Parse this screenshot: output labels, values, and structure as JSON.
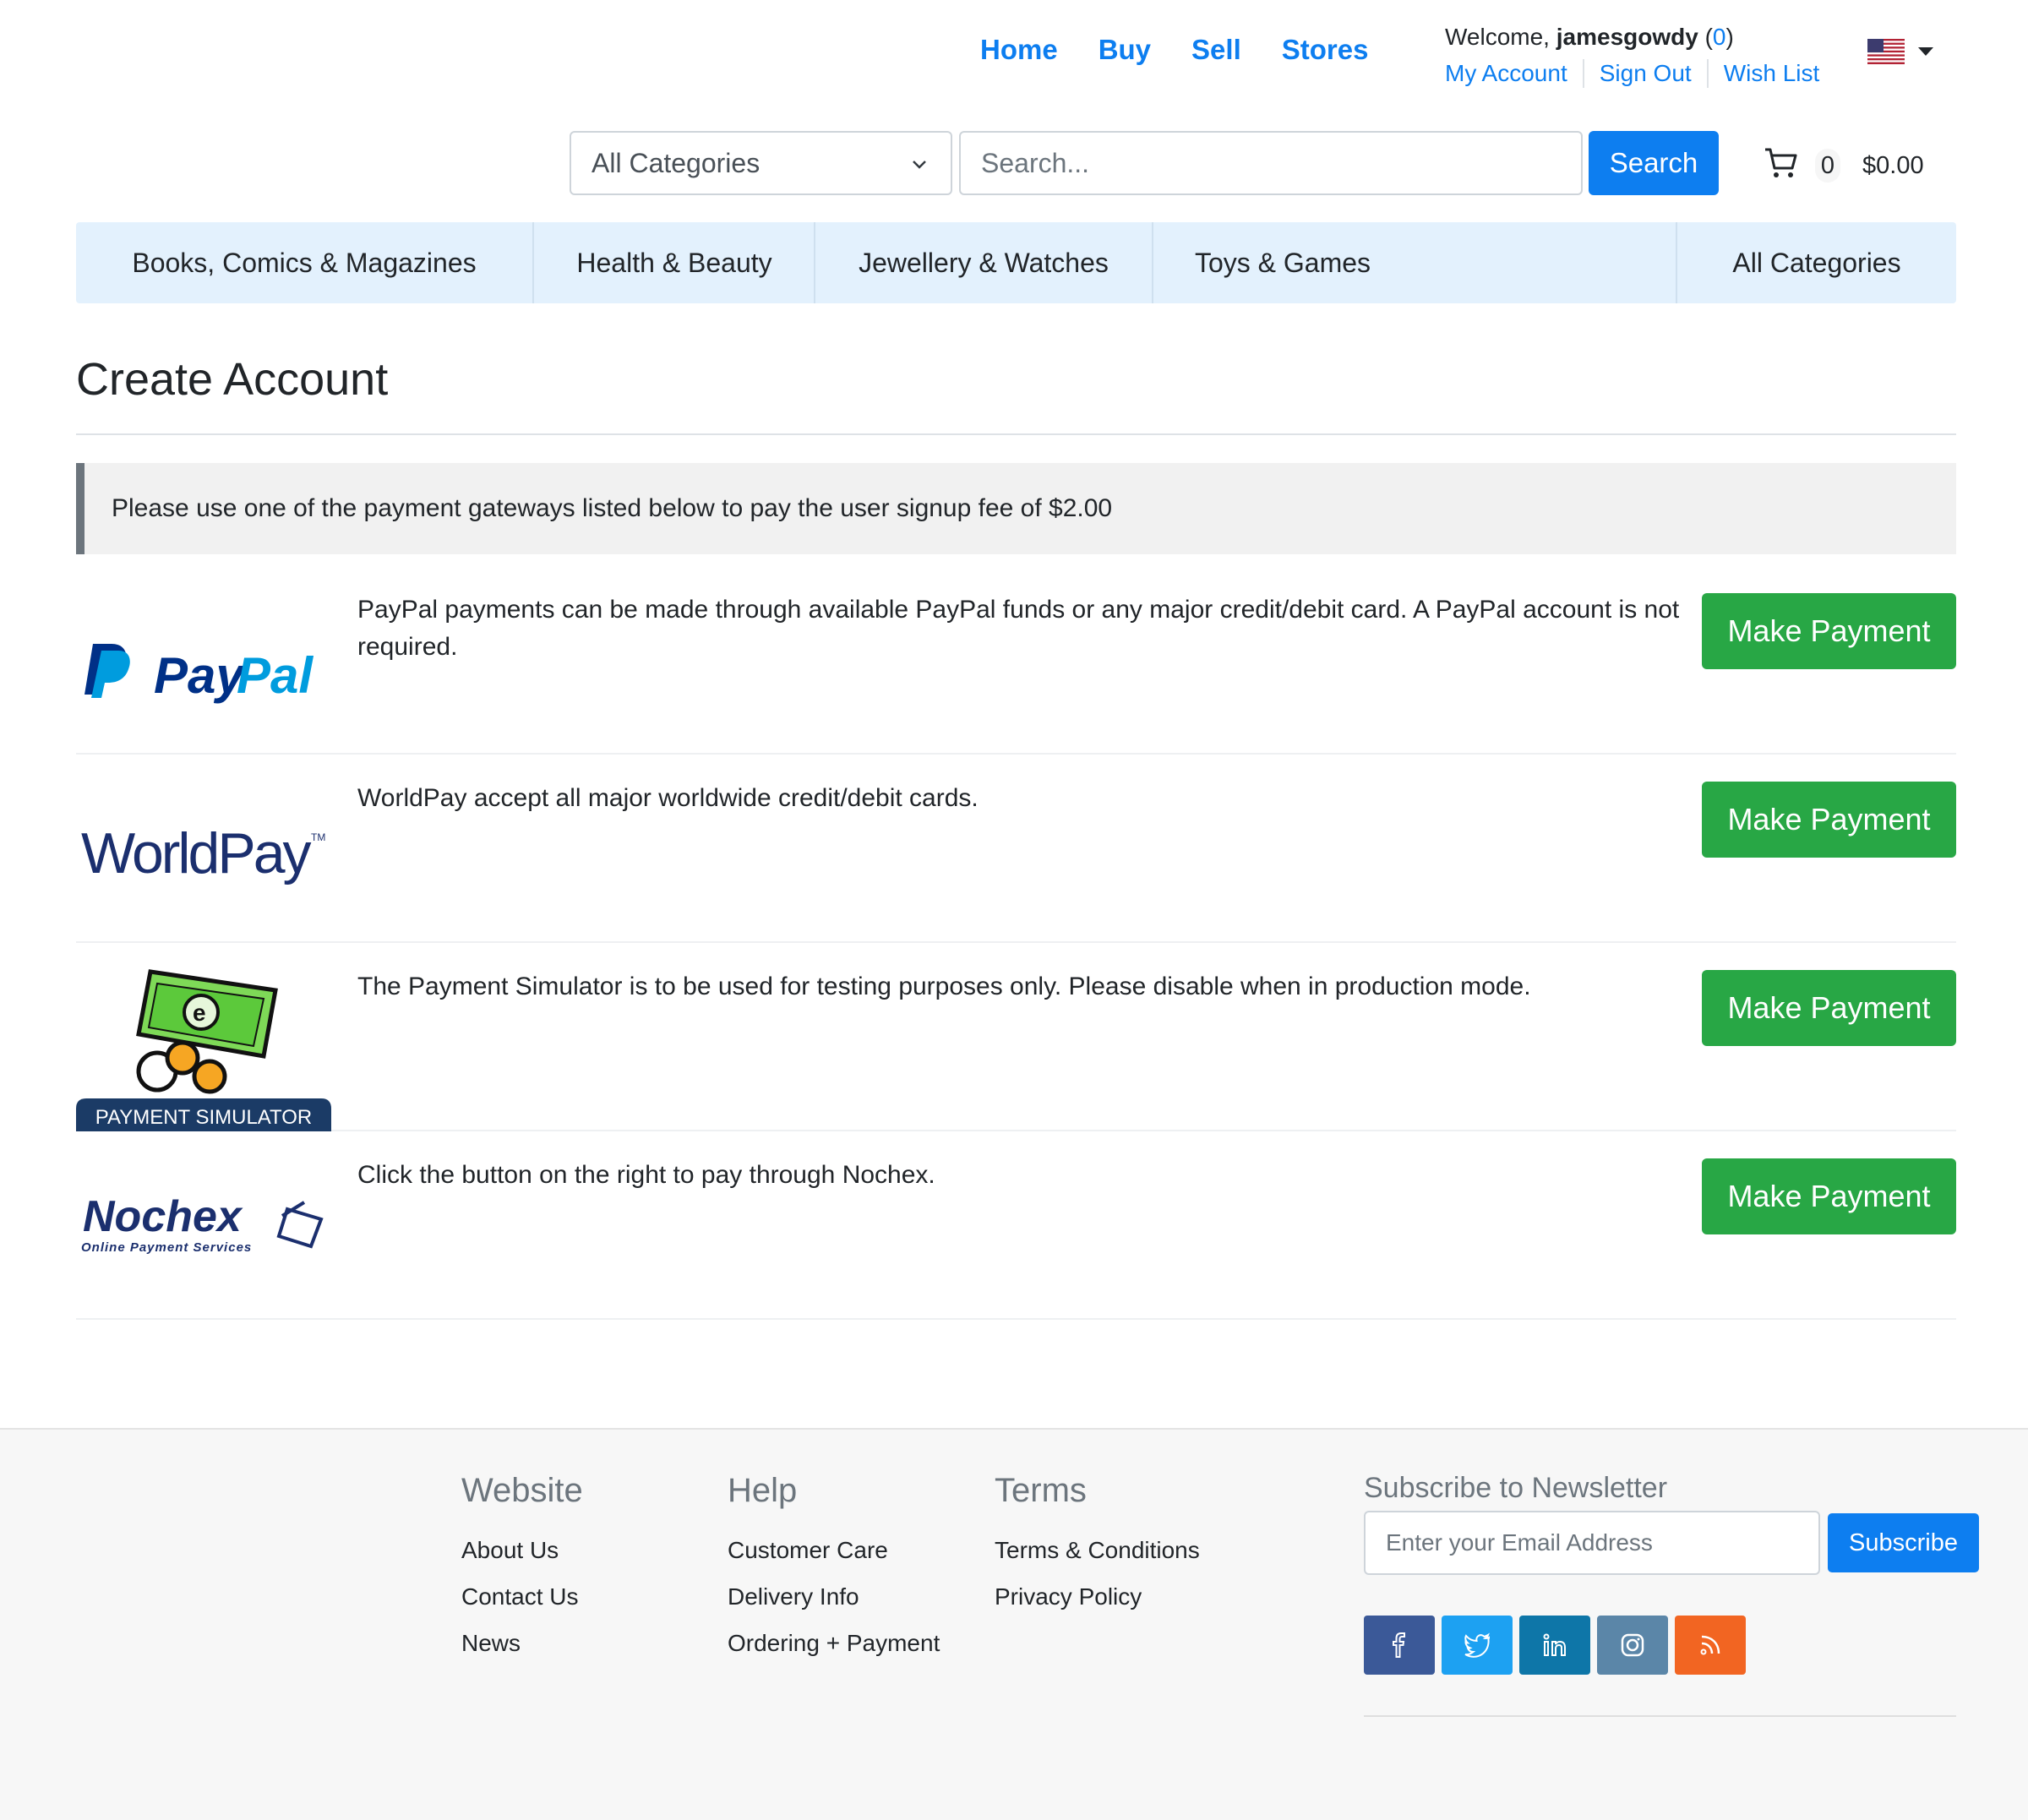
{
  "nav": {
    "home": "Home",
    "buy": "Buy",
    "sell": "Sell",
    "stores": "Stores"
  },
  "account": {
    "welcome_prefix": "Welcome,",
    "username": "jamesgowdy",
    "watch_count": "0",
    "my_account": "My Account",
    "sign_out": "Sign Out",
    "wish_list": "Wish List"
  },
  "search": {
    "category_selected": "All Categories",
    "placeholder": "Search...",
    "button": "Search"
  },
  "cart": {
    "count": "0",
    "total": "$0.00"
  },
  "categories": [
    "Books, Comics & Magazines",
    "Health & Beauty",
    "Jewellery & Watches",
    "Toys & Games",
    "All Categories"
  ],
  "page": {
    "title": "Create Account",
    "notice": "Please use one of the payment gateways listed below to pay the user signup fee of $2.00"
  },
  "gateways": [
    {
      "logo_text": "PayPal",
      "description": "PayPal payments can be made through available PayPal funds or any major credit/debit card. A PayPal account is not required.",
      "button": "Make Payment"
    },
    {
      "logo_text": "WorldPay",
      "description": "WorldPay accept all major worldwide credit/debit cards.",
      "button": "Make Payment"
    },
    {
      "logo_text": "PAYMENT SIMULATOR",
      "description": "The Payment Simulator is to be used for testing purposes only. Please disable when in production mode.",
      "button": "Make Payment"
    },
    {
      "logo_text": "Nochex",
      "logo_subtext": "Online Payment Services",
      "description": "Click the button on the right to pay through Nochex.",
      "button": "Make Payment"
    }
  ],
  "footer": {
    "website": {
      "title": "Website",
      "links": [
        "About Us",
        "Contact Us",
        "News"
      ]
    },
    "help": {
      "title": "Help",
      "links": [
        "Customer Care",
        "Delivery Info",
        "Ordering + Payment"
      ]
    },
    "terms": {
      "title": "Terms",
      "links": [
        "Terms & Conditions",
        "Privacy Policy"
      ]
    },
    "newsletter": {
      "title": "Subscribe to Newsletter",
      "placeholder": "Enter your Email Address",
      "button": "Subscribe"
    },
    "social": [
      {
        "icon": "facebook-icon",
        "color": "#3b5998"
      },
      {
        "icon": "twitter-icon",
        "color": "#1da1f2"
      },
      {
        "icon": "linkedin-icon",
        "color": "#0e76a8"
      },
      {
        "icon": "instagram-icon",
        "color": "#5b86a8"
      },
      {
        "icon": "rss-icon",
        "color": "#f26522"
      }
    ]
  },
  "colors": {
    "primary": "#0d7ef0",
    "success": "#28a745",
    "category_bar": "#e3f1fd"
  }
}
